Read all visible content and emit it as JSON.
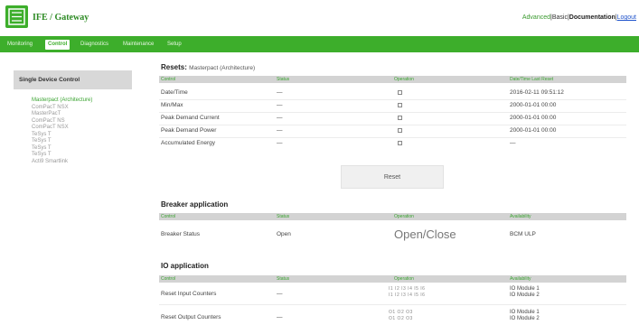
{
  "header": {
    "brand": "IFE / Gateway",
    "links": [
      "Advanced",
      "Basic",
      "Documentation",
      "Logout"
    ]
  },
  "nav": {
    "tabs": [
      "Monitoring",
      "Control",
      "Diagnostics",
      "Maintenance",
      "Setup"
    ],
    "active": "Control"
  },
  "sidebar": {
    "title": "Single Device Control",
    "items": [
      "Masterpact (Architecture)",
      "ComPacT NSX",
      "MasterPacT",
      "ComPacT NS",
      "ComPacT NSX",
      "TeSys T",
      "TeSys T",
      "TeSys T",
      "TeSys T",
      "Acti9 Smartlink"
    ]
  },
  "resets": {
    "title": "Resets",
    "subtitle": "Masterpact (Architecture)",
    "columns": [
      "Control",
      "Status",
      "Operation",
      "Date/Time Last Reset"
    ],
    "rows": [
      {
        "control": "Date/Time",
        "status": "—",
        "last_reset": "2016-02-11 09:51:12"
      },
      {
        "control": "Min/Max",
        "status": "—",
        "last_reset": "2000-01-01 00:00"
      },
      {
        "control": "Peak Demand Current",
        "status": "—",
        "last_reset": "2000-01-01 00:00"
      },
      {
        "control": "Peak Demand Power",
        "status": "—",
        "last_reset": "2000-01-01 00:00"
      },
      {
        "control": "Accumulated Energy",
        "status": "—",
        "last_reset": "—"
      }
    ],
    "reset_label": "Reset"
  },
  "breaker": {
    "title": "Breaker application",
    "columns": [
      "Control",
      "Status",
      "Operation",
      "Availability"
    ],
    "row": {
      "control": "Breaker Status",
      "status": "Open",
      "operation": "Open/Close",
      "availability": "BCM ULP"
    }
  },
  "io": {
    "title": "IO application",
    "columns": [
      "Control",
      "Status",
      "Operation",
      "Availability"
    ],
    "rows": [
      {
        "control": "Reset Input Counters",
        "status": "—",
        "op_line1": "I1   I2   I3   I4   I5   I6",
        "op_line2": "I1   I2   I3   I4   I5   I6",
        "avail_line1": "IO Module 1",
        "avail_line2": "IO Module 2"
      },
      {
        "control": "Reset Output Counters",
        "status": "—",
        "op_line1": "O1   O2   O3",
        "op_line2": "O1   O2   O3",
        "avail_line1": "IO Module 1",
        "avail_line2": "IO Module 2"
      }
    ]
  },
  "colors": {
    "accent": "#3dae2b",
    "header_bg": "#d3d3d3"
  }
}
